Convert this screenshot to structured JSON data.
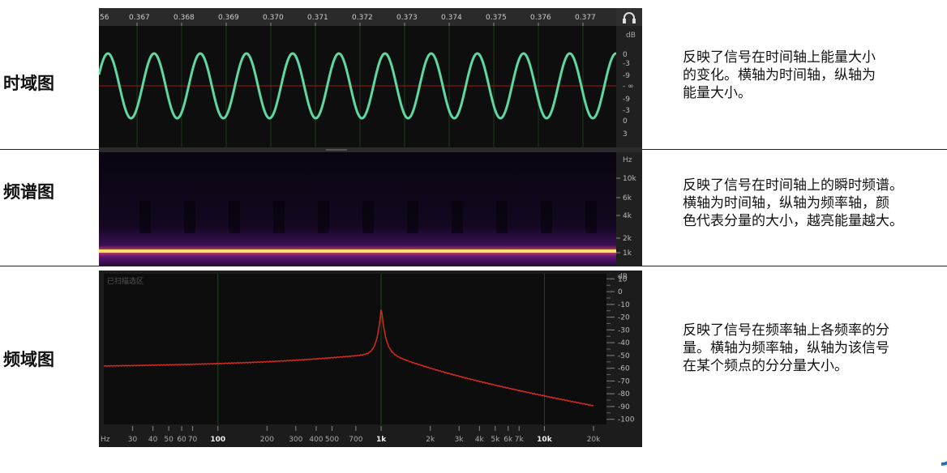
{
  "rows": [
    {
      "label": "时域图",
      "description": "反映了信号在时间轴上能量大小\n的变化。横轴为时间轴，纵轴为\n能量大小。"
    },
    {
      "label": "频谱图",
      "description": "反映了信号在时间轴上的瞬时频谱。\n横轴为时间轴，纵轴为频率轴，颜\n色代表分量的大小，越亮能量越大。"
    },
    {
      "label": "频域图",
      "description": "反映了信号在频率轴上各频率的分\n量。横轴为频率轴，纵轴为该信号\n在某个频点的分分量大小。"
    }
  ],
  "waveform": {
    "time_ticks": [
      "56",
      "0.367",
      "0.368",
      "0.369",
      "0.370",
      "0.371",
      "0.372",
      "0.373",
      "0.374",
      "0.375",
      "0.376",
      "0.377"
    ],
    "db_unit": "dB",
    "db_ticks": [
      "0",
      "-3",
      "-9",
      "- ∞",
      "-9",
      "-3",
      "0",
      "3"
    ],
    "wave_color": "#5ed8a0",
    "headphone_icon": "headphone-icon"
  },
  "spectrogram": {
    "unit": "Hz",
    "freq_ticks": [
      "10k",
      "6k",
      "4k",
      "2k",
      "1k"
    ],
    "band_color": "#ffe070"
  },
  "spectrum": {
    "overlay_label": "已扫描选区",
    "db_unit": "dB",
    "db_ticks": [
      "10",
      "0",
      "-10",
      "-20",
      "-30",
      "-40",
      "-50",
      "-60",
      "-70",
      "-80",
      "-90",
      "-100"
    ],
    "freq_unit": "Hz",
    "freq_ticks": [
      "30",
      "40",
      "50",
      "60",
      "70",
      "100",
      "200",
      "300",
      "400",
      "500",
      "700",
      "1k",
      "2k",
      "3k",
      "4k",
      "5k",
      "6k",
      "7k",
      "10k",
      "20k"
    ],
    "line_color": "#d42a22"
  }
}
